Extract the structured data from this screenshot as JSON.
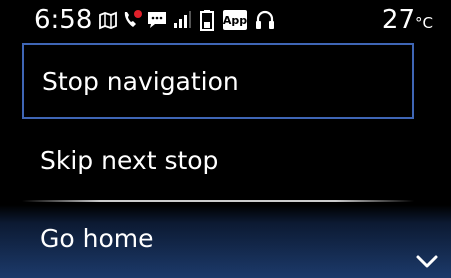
{
  "status_bar": {
    "time": "6:58",
    "icons": [
      "map-icon",
      "phone-missed-icon",
      "message-icon",
      "signal-icon",
      "battery-icon",
      "app-badge-icon",
      "headset-icon"
    ],
    "app_badge_text": "App",
    "temperature": "27",
    "temperature_unit": "°C"
  },
  "menu": {
    "items": [
      {
        "label": "Stop navigation",
        "selected": true
      },
      {
        "label": "Skip next stop",
        "selected": false
      },
      {
        "label": "Go home",
        "selected": false
      }
    ]
  },
  "colors": {
    "background": "#000000",
    "selection_border": "#3f66b5",
    "bottom_gradient": "#1c3a6a",
    "phone_missed": "#e0202a"
  }
}
